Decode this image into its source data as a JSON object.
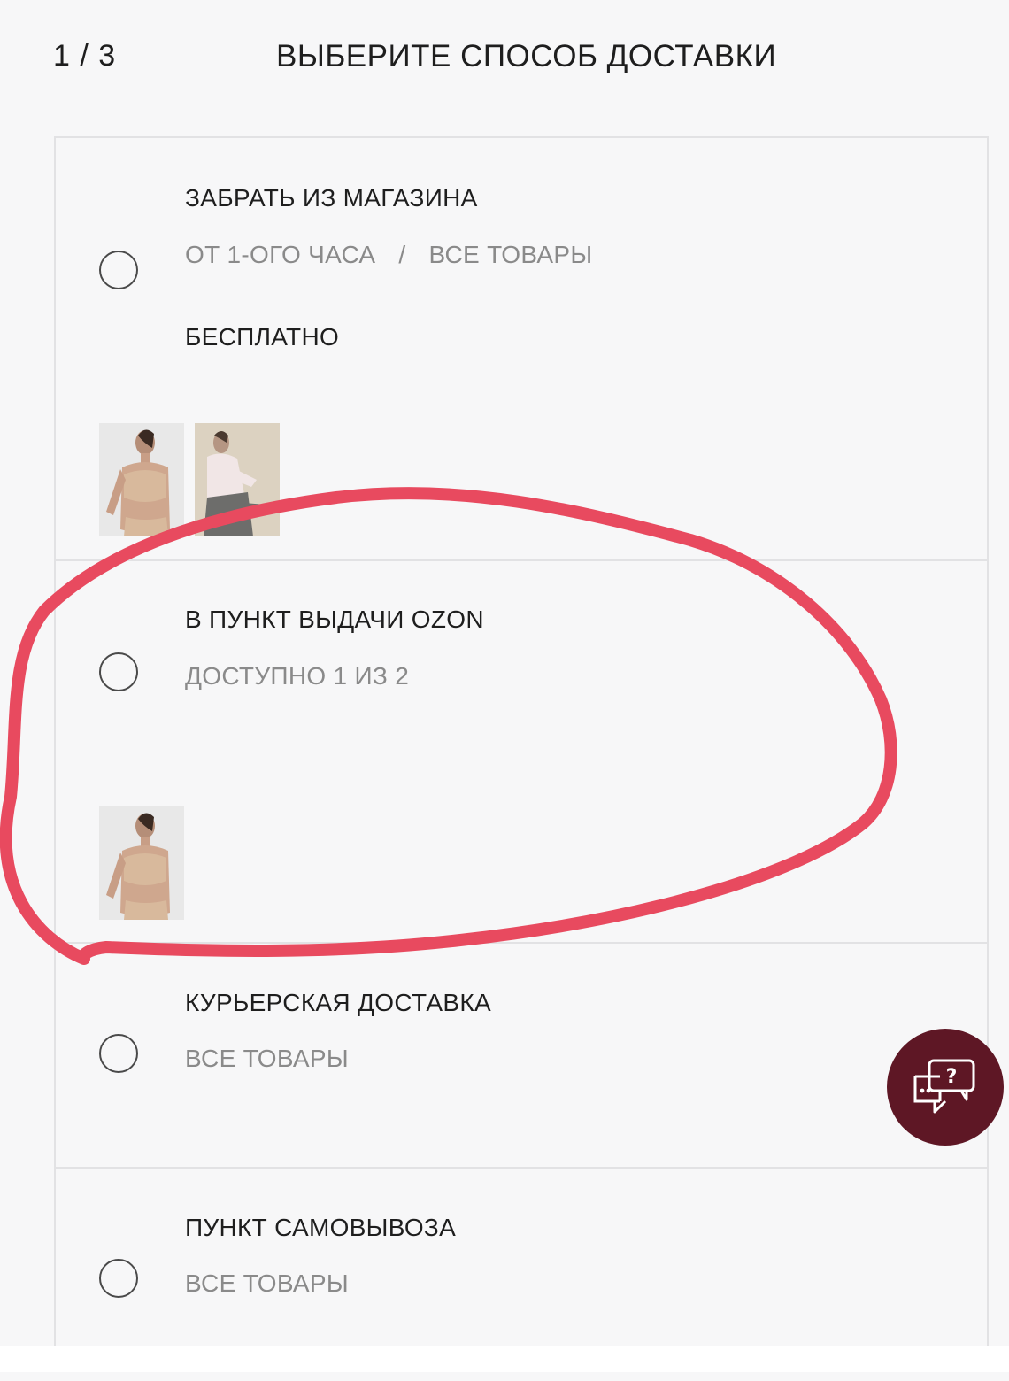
{
  "header": {
    "step": "1 / 3",
    "title": "ВЫБЕРИТЕ СПОСОБ ДОСТАВКИ"
  },
  "options": [
    {
      "title": "ЗАБРАТЬ ИЗ МАГАЗИНА",
      "time": "ОТ 1-ОГО ЧАСА",
      "separator": "/",
      "availability": "ВСЕ ТОВАРЫ",
      "price": "БЕСПЛАТНО"
    },
    {
      "title": "В ПУНКТ ВЫДАЧИ OZON",
      "availability": "ДОСТУПНО 1 ИЗ 2"
    },
    {
      "title": "КУРЬЕРСКАЯ ДОСТАВКА",
      "availability": "ВСЕ ТОВАРЫ"
    },
    {
      "title": "ПУНКТ САМОВЫВОЗА",
      "availability": "ВСЕ ТОВАРЫ"
    }
  ],
  "icons": {
    "chat": "chat-help-icon",
    "radio": "radio-unselected-icon"
  },
  "colors": {
    "accent": "#5e1725",
    "annotation": "#e84a5f",
    "muted_text": "#8a8a8a"
  }
}
